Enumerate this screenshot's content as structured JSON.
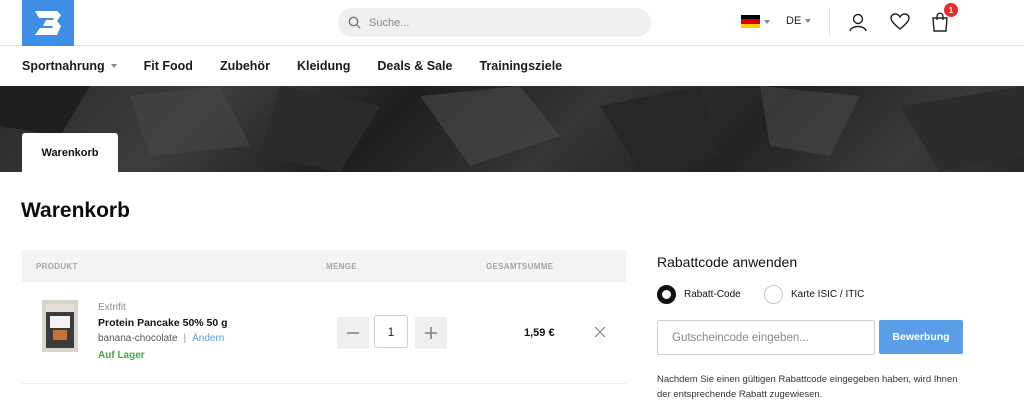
{
  "header": {
    "search_placeholder": "Suche...",
    "language": "DE",
    "cart_count": "1",
    "flag_colors": [
      "#000000",
      "#dd0000",
      "#ffce00"
    ],
    "brand_color": "#3f8ee6"
  },
  "nav": {
    "items": [
      {
        "label": "Sportnahrung",
        "has_dropdown": true
      },
      {
        "label": "Fit Food"
      },
      {
        "label": "Zubehör"
      },
      {
        "label": "Kleidung"
      },
      {
        "label": "Deals & Sale"
      },
      {
        "label": "Trainingsziele"
      }
    ]
  },
  "banner": {
    "tab_label": "Warenkorb"
  },
  "page": {
    "title": "Warenkorb"
  },
  "cart": {
    "columns": {
      "product": "PRODUKT",
      "quantity": "MENGE",
      "total": "GESAMTSUMME"
    },
    "items": [
      {
        "brand": "Extrifit",
        "name": "Protein Pancake 50% 50 g",
        "variant": "banana-chocolate",
        "change_label": "Ändern",
        "stock": "Auf Lager",
        "quantity": "1",
        "total": "1,59 €"
      }
    ]
  },
  "coupon": {
    "title": "Rabattcode anwenden",
    "options": [
      {
        "label": "Rabatt-Code",
        "selected": true
      },
      {
        "label": "Karte ISIC / ITIC",
        "selected": false
      }
    ],
    "input_placeholder": "Gutscheincode eingeben...",
    "apply_label": "Bewerbung",
    "hint": "Nachdem Sie einen gültigen Rabattcode eingegeben haben, wird Ihnen der entsprechende Rabatt zugewiesen.",
    "accent_color": "#5b9ee8"
  }
}
